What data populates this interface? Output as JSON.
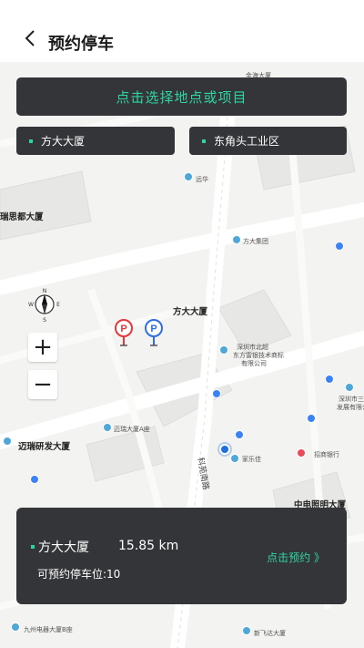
{
  "header": {
    "title": "预约停车"
  },
  "select_bar": {
    "label": "点击选择地点或项目"
  },
  "chips": [
    {
      "label": "方大大厦"
    },
    {
      "label": "东角头工业区"
    }
  ],
  "zoom": {
    "in_label": "+",
    "out_label": "−"
  },
  "compass": {
    "n": "N",
    "s": "S",
    "w": "W",
    "e": "E"
  },
  "map_labels": {
    "l1": "金海大厦",
    "l2": "远华",
    "l3": "瑞思都大厦",
    "l4": "方大集团",
    "l5": "方大大厦",
    "l6": "深圳市北超",
    "l7": "东方雷银技术商标",
    "l8": "有限公司",
    "l9": "迈瑞大厦A座",
    "l10": "迈瑞研发大厦",
    "l11": "家乐佳",
    "l12": "招商银行",
    "l13": "中电照明大厦",
    "l14": "深圳市三匹",
    "l15": "发展有限公",
    "l16": "九州电器大厦B座",
    "l17": "新飞达大厦",
    "l18": "科苑南路",
    "l19": "海安"
  },
  "card": {
    "name": "方大大厦",
    "distance": "15.85 km",
    "slots": "可预约停车位:10",
    "reserve_label": "点击预约 》"
  },
  "colors": {
    "accent": "#2fd4a3",
    "panel": "#343538",
    "pin_red": "#e23a3a",
    "pin_blue": "#2f6fe0"
  }
}
